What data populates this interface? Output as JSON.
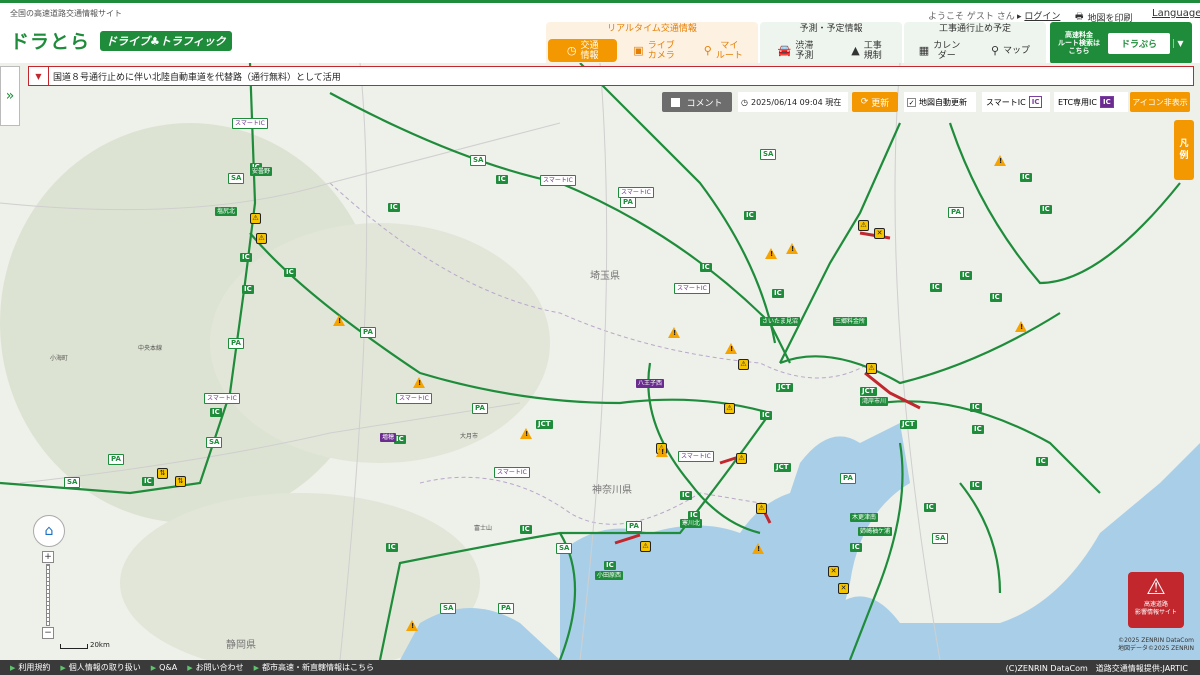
{
  "header": {
    "caption": "全国の高速道路交通情報サイト",
    "logo_main": "ドラとら",
    "logo_sub": "ドライブ♣トラフィック",
    "welcome": "ようこそ ゲスト さん",
    "login": "ログイン",
    "print": "地図を印刷",
    "language": "Language"
  },
  "nav": {
    "realtime": {
      "title": "リアルタイム交通情報",
      "items": [
        {
          "label": "交通\n情報",
          "icon": "clock-icon",
          "active": true
        },
        {
          "label": "ライブ\nカメラ",
          "icon": "camera-icon"
        },
        {
          "label": "マイ\nルート",
          "icon": "route-icon"
        }
      ]
    },
    "forecast": {
      "title": "予測・予定情報",
      "items": [
        {
          "label": "渋滞\n予測",
          "icon": "car-icon"
        },
        {
          "label": "工事\n規制",
          "icon": "construction-icon"
        }
      ]
    },
    "closure": {
      "title": "工事通行止め予定",
      "items": [
        {
          "label": "カレン\nダー",
          "icon": "calendar-icon"
        },
        {
          "label": "マップ",
          "icon": "map-pin-icon"
        }
      ]
    },
    "search": {
      "text": "高速料金\nルート検索は\nこちら",
      "brand": "ドラぷら"
    }
  },
  "notice": "国道８号通行止めに伴い北陸自動車道を代替路（通行無料）として活用",
  "toolbar": {
    "comment": "コメント",
    "datetime": "2025/06/14 09:04 現在",
    "refresh": "更新",
    "auto_update": "地図自動更新",
    "smart_ic": "スマートIC",
    "etc_ic": "ETC専用IC",
    "ic_tag": "IC",
    "icon_hide": "アイコン非表示"
  },
  "legend": "凡\n例",
  "scale": "20km",
  "emergency": {
    "line1": "高速道路",
    "line2": "影響情報サイト"
  },
  "copyright": [
    "©2025 ZENRIN DataCom",
    "地図データ©2025 ZENRIN"
  ],
  "map": {
    "prefectures": [
      "埼玉県",
      "神奈川県",
      "静岡県"
    ],
    "places": [
      "中央本線",
      "小海町",
      "大月市",
      "富士山"
    ]
  },
  "footer": {
    "links": [
      "利用規約",
      "個人情報の取り扱い",
      "Q&A",
      "お問い合わせ",
      "都市高速・新直轄情報はこちら"
    ],
    "credit": "(C)ZENRIN DataCom　道路交通情報提供:JARTIC"
  },
  "colors": {
    "brand_green": "#1e8c3a",
    "accent_orange": "#f39800",
    "alert_red": "#c1272d",
    "sea": "#a9cfe8"
  }
}
